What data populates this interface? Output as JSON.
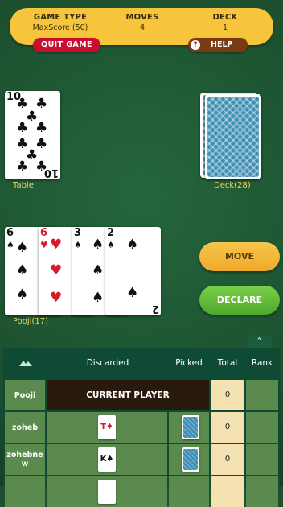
{
  "header": {
    "game_type_label": "GAME TYPE",
    "game_type_value": "MaxScore (50)",
    "moves_label": "MOVES",
    "moves_value": "4",
    "deck_label": "DECK",
    "deck_value": "1",
    "quit_label": "QUIT GAME",
    "help_label": "HELP",
    "help_icon": "?"
  },
  "table": {
    "label": "Table",
    "card": {
      "rank": "10",
      "suit": "♣",
      "color": "black"
    }
  },
  "deck": {
    "label": "Deck(28)"
  },
  "hand": {
    "label": "Pooji(17)",
    "cards": [
      {
        "rank": "6",
        "suit": "♠",
        "color": "black"
      },
      {
        "rank": "6",
        "suit": "♥",
        "color": "red"
      },
      {
        "rank": "3",
        "suit": "♠",
        "color": "black"
      },
      {
        "rank": "2",
        "suit": "♠",
        "color": "black"
      }
    ]
  },
  "actions": {
    "move_label": "MOVE",
    "declare_label": "DECLARE",
    "collapse_icon": "⌃"
  },
  "scoreboard": {
    "headers": {
      "discarded": "Discarded",
      "picked": "Picked",
      "total": "Total",
      "rank": "Rank"
    },
    "players": [
      {
        "name": "Pooji",
        "current_label": "CURRENT PLAYER",
        "total": "0"
      },
      {
        "name": "zoheb",
        "discarded": "T♦",
        "discarded_color": "red",
        "total": "0"
      },
      {
        "name": "zohebne w",
        "discarded": "K♠",
        "discarded_color": "black",
        "total": "0"
      }
    ]
  },
  "colors": {
    "felt": "#1f5a34",
    "panel": "#f6c53c",
    "quit": "#c8102e",
    "help": "#7a3a12",
    "move": "#f0a92b",
    "declare": "#4ea82b"
  }
}
